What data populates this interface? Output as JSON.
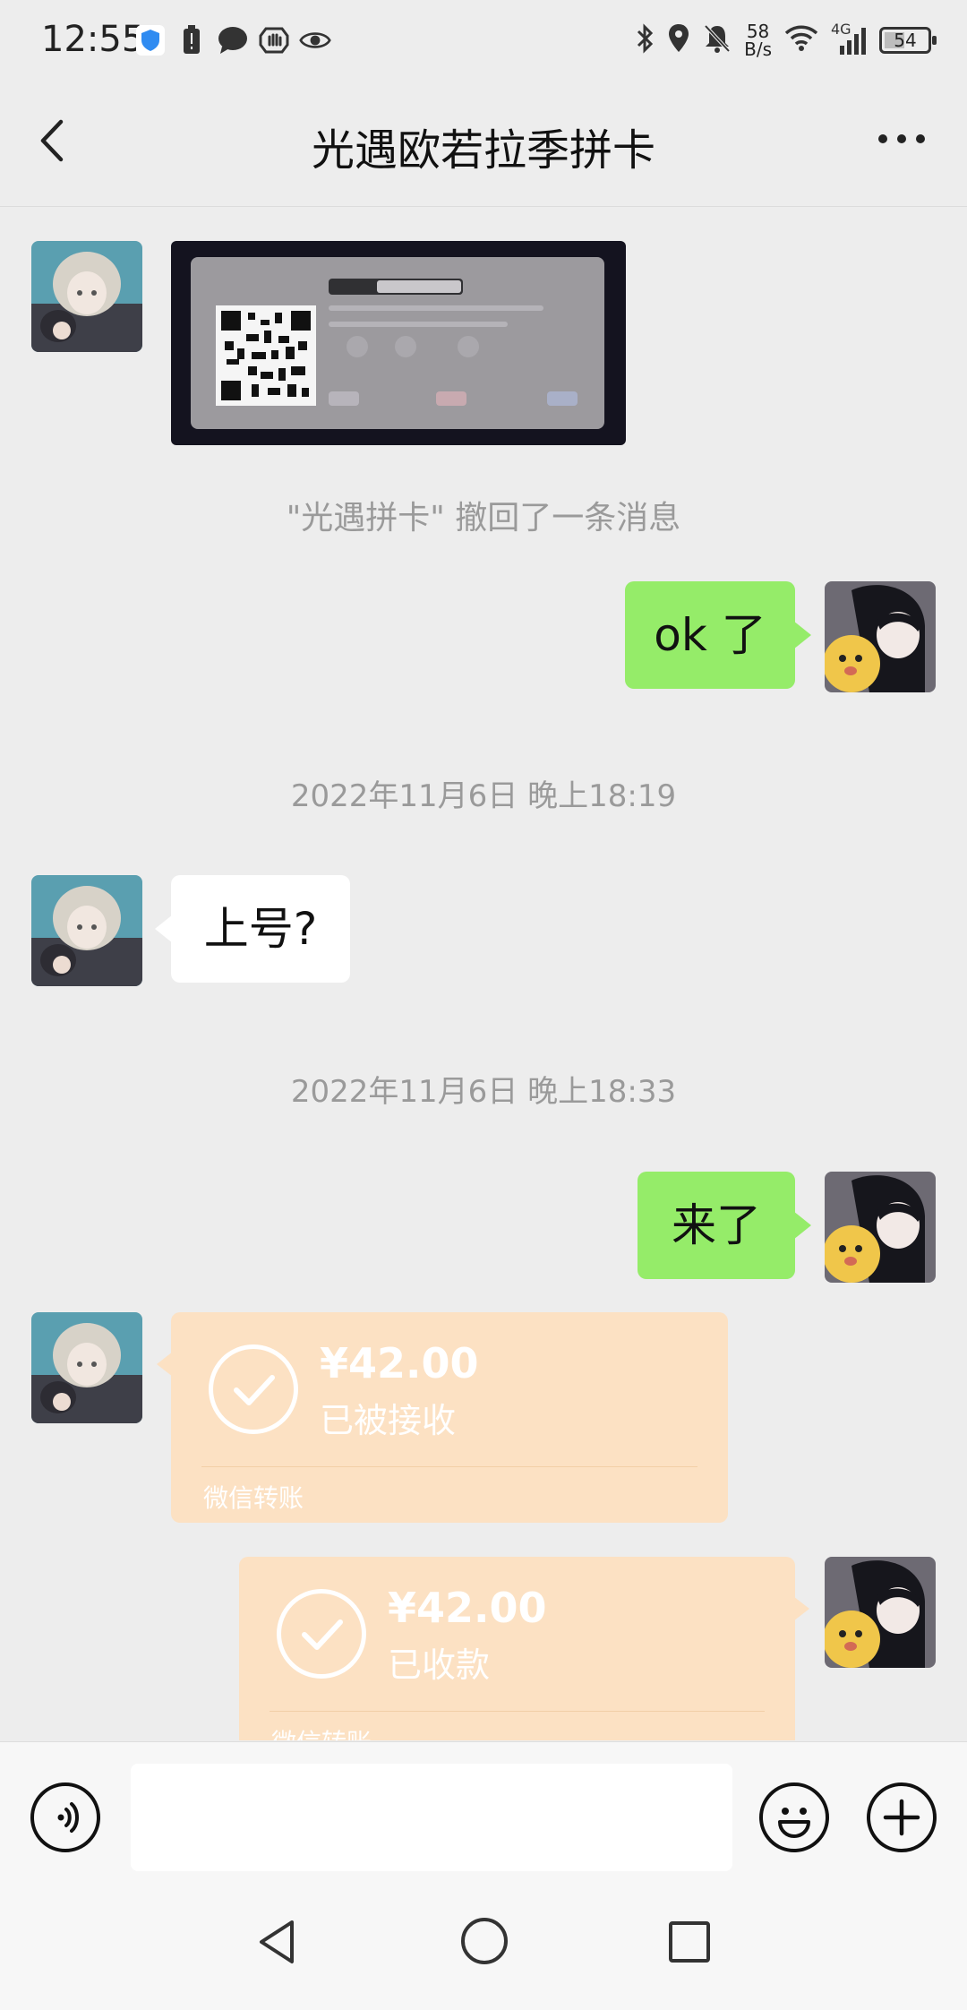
{
  "status_bar": {
    "time": "12:55",
    "net_speed_value": "58",
    "net_speed_unit": "B/s",
    "signal_type": "4G",
    "battery_level": "54",
    "left_icons": [
      "shield-icon",
      "battery-alert-icon",
      "chat-icon",
      "hand-icon",
      "eye-icon"
    ],
    "right_icons": [
      "bluetooth-icon",
      "location-icon",
      "mute-bell-icon",
      "wifi-icon",
      "cell-signal-icon",
      "battery-icon"
    ]
  },
  "header": {
    "title": "光遇欧若拉季拼卡",
    "back_icon": "chevron-left-icon",
    "more_icon": "more-dots-icon"
  },
  "messages": {
    "recall_notice": "\"光遇拼卡\" 撤回了一条消息",
    "msg_ok": "ok 了",
    "timestamp_1": "2022年11月6日 晚上18:19",
    "msg_shanghao": "上号?",
    "timestamp_2": "2022年11月6日 晚上18:33",
    "msg_laile": "来了",
    "transfer_received": {
      "amount": "¥42.00",
      "status": "已被接收",
      "footer": "微信转账"
    },
    "transfer_collected": {
      "amount": "¥42.00",
      "status": "已收款",
      "footer": "微信转账"
    }
  },
  "input_bar": {
    "voice_icon": "voice-icon",
    "emoji_icon": "emoji-icon",
    "plus_icon": "plus-icon",
    "input_value": ""
  },
  "nav_bar": {
    "icons": [
      "nav-back-icon",
      "nav-home-icon",
      "nav-recents-icon"
    ]
  },
  "colors": {
    "background": "#ededed",
    "sent_bubble": "#95ec69",
    "received_bubble": "#ffffff",
    "transfer_card": "#fce1c3"
  }
}
